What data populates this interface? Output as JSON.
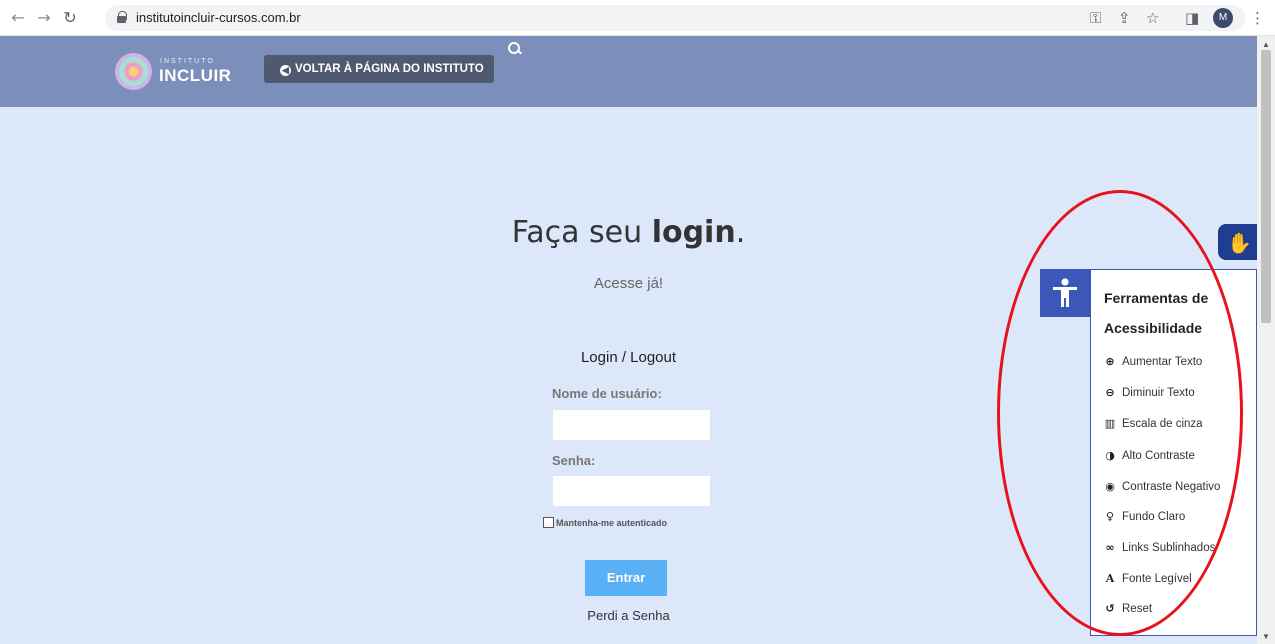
{
  "browser": {
    "url": "institutoincluir-cursos.com.br",
    "avatar_letter": "M"
  },
  "header": {
    "logo_small": "INSTITUTO",
    "logo_big": "INCLUIR",
    "back_button": "VOLTAR À PÁGINA DO INSTITUTO"
  },
  "login": {
    "title_prefix": "Faça seu ",
    "title_bold": "login",
    "title_suffix": ".",
    "subtitle": "Acesse já!",
    "form_heading": "Login / Logout",
    "username_label": "Nome de usuário:",
    "password_label": "Senha:",
    "remember_label": "Mantenha-me autenticado",
    "submit": "Entrar",
    "forgot": "Perdi a Senha"
  },
  "accessibility": {
    "title": "Ferramentas de Acessibilidade",
    "items": [
      {
        "icon": "zoom-in-icon",
        "glyph": "⊕",
        "label": "Aumentar Texto"
      },
      {
        "icon": "zoom-out-icon",
        "glyph": "⊖",
        "label": "Diminuir Texto"
      },
      {
        "icon": "barcode-icon",
        "glyph": "▥",
        "label": "Escala de cinza"
      },
      {
        "icon": "contrast-icon",
        "glyph": "◑",
        "label": "Alto Contraste"
      },
      {
        "icon": "eye-icon",
        "glyph": "◉",
        "label": "Contraste Negativo"
      },
      {
        "icon": "lightbulb-icon",
        "glyph": "♀",
        "label": "Fundo Claro"
      },
      {
        "icon": "link-icon",
        "glyph": "∞",
        "label": "Links Sublinhados"
      },
      {
        "icon": "font-icon",
        "glyph": "A",
        "label": "Fonte Legível"
      },
      {
        "icon": "reset-icon",
        "glyph": "↺",
        "label": "Reset"
      }
    ]
  },
  "colors": {
    "header_bg": "#7b8fba",
    "page_bg": "#dce8fa",
    "accent": "#3b57b8",
    "button": "#5ab0f5",
    "annotation": "#e8121c"
  }
}
